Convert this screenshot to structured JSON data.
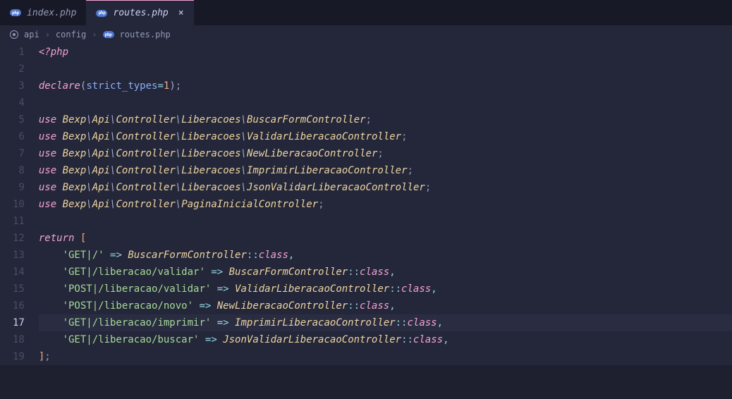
{
  "tabs": [
    {
      "label": "index.php",
      "active": false
    },
    {
      "label": "routes.php",
      "active": true
    }
  ],
  "breadcrumbs": {
    "segments": [
      "api",
      "config",
      "routes.php"
    ]
  },
  "editor": {
    "current_line": 17,
    "lines_count": 19,
    "code": {
      "open_tag": "<?php",
      "declare": {
        "keyword": "declare",
        "option": "strict_types",
        "value": "1"
      },
      "uses": [
        [
          "Bexp",
          "Api",
          "Controller",
          "Liberacoes",
          "BuscarFormController"
        ],
        [
          "Bexp",
          "Api",
          "Controller",
          "Liberacoes",
          "ValidarLiberacaoController"
        ],
        [
          "Bexp",
          "Api",
          "Controller",
          "Liberacoes",
          "NewLiberacaoController"
        ],
        [
          "Bexp",
          "Api",
          "Controller",
          "Liberacoes",
          "ImprimirLiberacaoController"
        ],
        [
          "Bexp",
          "Api",
          "Controller",
          "Liberacoes",
          "JsonValidarLiberacaoController"
        ],
        [
          "Bexp",
          "Api",
          "Controller",
          "PaginaInicialController"
        ]
      ],
      "return_keyword": "return",
      "routes": [
        {
          "key": "'GET|/'",
          "controller": "BuscarFormController"
        },
        {
          "key": "'GET|/liberacao/validar'",
          "controller": "BuscarFormController"
        },
        {
          "key": "'POST|/liberacao/validar'",
          "controller": "ValidarLiberacaoController"
        },
        {
          "key": "'POST|/liberacao/novo'",
          "controller": "NewLiberacaoController"
        },
        {
          "key": "'GET|/liberacao/imprimir'",
          "controller": "ImprimirLiberacaoController"
        },
        {
          "key": "'GET|/liberacao/buscar'",
          "controller": "JsonValidarLiberacaoController"
        }
      ],
      "class_keyword": "class"
    }
  }
}
